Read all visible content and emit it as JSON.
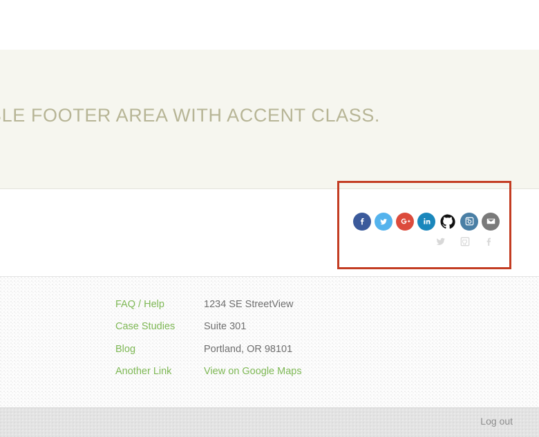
{
  "accent_section": {
    "headline": "BLE FOOTER AREA WITH ACCENT CLASS.",
    "background_color": "#f6f6ef",
    "text_color": "#b7b596"
  },
  "highlight": {
    "color": "#c33c22",
    "label": "social-icons-highlight"
  },
  "social": {
    "primary_icons": [
      {
        "name": "facebook-icon",
        "label": "Facebook",
        "color": "#3b5a9b"
      },
      {
        "name": "twitter-icon",
        "label": "Twitter",
        "color": "#54b3ed"
      },
      {
        "name": "google-plus-icon",
        "label": "Google Plus",
        "color": "#dc4b3c"
      },
      {
        "name": "linkedin-icon",
        "label": "LinkedIn",
        "color": "#1a87bc"
      },
      {
        "name": "github-icon",
        "label": "GitHub",
        "color": "#000000"
      },
      {
        "name": "instagram-icon",
        "label": "Instagram",
        "color": "#4a7fa5"
      },
      {
        "name": "email-icon",
        "label": "Email",
        "color": "#7a7a7a"
      }
    ],
    "secondary_icons": [
      {
        "name": "twitter-bird-icon",
        "label": "Twitter",
        "color": "#d8d8d8"
      },
      {
        "name": "github-outline-icon",
        "label": "GitHub",
        "color": "#d8d8d8"
      },
      {
        "name": "facebook-f-icon",
        "label": "Facebook",
        "color": "#d8d8d8"
      }
    ]
  },
  "footer": {
    "links": [
      {
        "label": "FAQ / Help"
      },
      {
        "label": "Case Studies"
      },
      {
        "label": "Blog"
      },
      {
        "label": "Another Link"
      }
    ],
    "address": [
      {
        "label": "1234 SE StreetView",
        "link": false
      },
      {
        "label": "Suite 301",
        "link": false
      },
      {
        "label": "Portland, OR 98101",
        "link": false
      },
      {
        "label": "View on Google Maps",
        "link": true
      }
    ],
    "link_color": "#7eb855",
    "text_color": "#6f6f6f"
  },
  "bottom_bar": {
    "logout_label": "Log out",
    "background_color": "#e3e3e3",
    "text_color": "#8c8c8c"
  }
}
